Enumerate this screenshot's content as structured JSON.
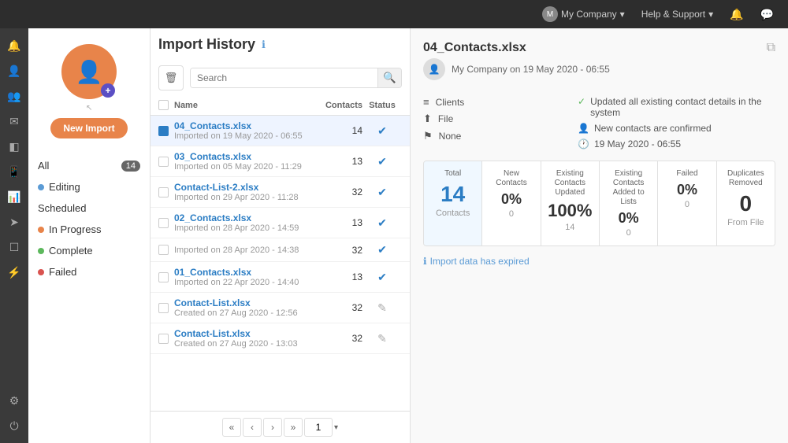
{
  "topbar": {
    "company_label": "My Company",
    "help_label": "Help & Support",
    "company_icon": "🏢",
    "chat_icon": "💬"
  },
  "sidebar_icons": [
    {
      "name": "bell-icon",
      "symbol": "🔔",
      "active": false
    },
    {
      "name": "user-icon",
      "symbol": "👤",
      "active": false
    },
    {
      "name": "contacts-icon",
      "symbol": "👥",
      "active": true
    },
    {
      "name": "email-icon",
      "symbol": "✉",
      "active": false
    },
    {
      "name": "layers-icon",
      "symbol": "◧",
      "active": false
    },
    {
      "name": "mobile-icon",
      "symbol": "📱",
      "active": false
    },
    {
      "name": "chart-icon",
      "symbol": "📊",
      "active": false
    },
    {
      "name": "send-icon",
      "symbol": "➤",
      "active": false
    },
    {
      "name": "box-icon",
      "symbol": "☐",
      "active": false
    },
    {
      "name": "bolt-icon",
      "symbol": "⚡",
      "active": false
    },
    {
      "name": "gear-icon-bottom",
      "symbol": "⚙",
      "active": false,
      "bottom": true
    },
    {
      "name": "power-icon",
      "symbol": "⏻",
      "active": false,
      "bottom": true
    }
  ],
  "left_panel": {
    "new_import_label": "New Import",
    "filters": [
      {
        "label": "All",
        "badge": "14",
        "dot": null
      },
      {
        "label": "Editing",
        "badge": null,
        "dot": "blue"
      },
      {
        "label": "Scheduled",
        "badge": null,
        "dot": null
      },
      {
        "label": "In Progress",
        "badge": null,
        "dot": "orange"
      },
      {
        "label": "Complete",
        "badge": null,
        "dot": "green"
      },
      {
        "label": "Failed",
        "badge": null,
        "dot": "red"
      }
    ]
  },
  "list_panel": {
    "title": "Import History",
    "trash_label": "delete",
    "search_placeholder": "Search",
    "columns": [
      "Name",
      "Contacts",
      "Status"
    ],
    "rows": [
      {
        "name": "04_Contacts.xlsx",
        "sub": "Imported on 19 May 2020 - 06:55",
        "contacts": 14,
        "status": "complete",
        "selected": true
      },
      {
        "name": "03_Contacts.xlsx",
        "sub": "Imported on 05 May 2020 - 11:29",
        "contacts": 13,
        "status": "complete",
        "selected": false
      },
      {
        "name": "Contact-List-2.xlsx",
        "sub": "Imported on 29 Apr 2020 - 11:28",
        "contacts": 32,
        "status": "complete",
        "selected": false
      },
      {
        "name": "02_Contacts.xlsx",
        "sub": "Imported on 28 Apr 2020 - 14:59",
        "contacts": 13,
        "status": "complete",
        "selected": false
      },
      {
        "name": "",
        "sub": "Imported on 28 Apr 2020 - 14:38",
        "contacts": 32,
        "status": "complete",
        "selected": false
      },
      {
        "name": "01_Contacts.xlsx",
        "sub": "Imported on 22 Apr 2020 - 14:40",
        "contacts": 13,
        "status": "complete",
        "selected": false
      },
      {
        "name": "Contact-List.xlsx",
        "sub": "Created on 27 Aug 2020 - 12:56",
        "contacts": 32,
        "status": "edit",
        "selected": false
      },
      {
        "name": "Contact-List.xlsx",
        "sub": "Created on 27 Aug 2020 - 13:03",
        "contacts": 32,
        "status": "edit",
        "selected": false
      }
    ],
    "pagination": {
      "page": "1",
      "prev_label": "‹",
      "prev_prev_label": "«",
      "next_label": "›",
      "next_next_label": "»"
    }
  },
  "detail": {
    "filename": "04_Contacts.xlsx",
    "meta_text": "My Company on 19 May 2020 - 06:55",
    "copy_icon": "⧉",
    "info_rows": [
      {
        "icon": "≡",
        "label": "Clients",
        "value": ""
      },
      {
        "icon": "⬆",
        "label": "File",
        "value": ""
      },
      {
        "icon": "⚑",
        "label": "None",
        "value": ""
      }
    ],
    "right_notes": [
      {
        "icon": "✓",
        "text": "Updated all existing contact details in the system"
      },
      {
        "icon": "👤",
        "text": "New contacts are confirmed"
      },
      {
        "icon": "🕐",
        "text": "19 May 2020 - 06:55"
      }
    ],
    "stats": [
      {
        "label": "Total",
        "value": "14",
        "sub": "Contacts",
        "type": "highlight"
      },
      {
        "label": "New Contacts",
        "value": "0%",
        "sub": "0",
        "type": "normal"
      },
      {
        "label": "Existing Contacts Updated",
        "value": "100%",
        "sub": "14",
        "type": "normal"
      },
      {
        "label": "Existing Contacts Added to Lists",
        "value": "0%",
        "sub": "0",
        "type": "normal"
      },
      {
        "label": "Failed",
        "value": "0%",
        "sub": "0",
        "type": "normal"
      },
      {
        "label": "Duplicates Removed",
        "value": "0",
        "sub": "From File",
        "type": "normal"
      }
    ],
    "info_note": "Import data has expired"
  }
}
